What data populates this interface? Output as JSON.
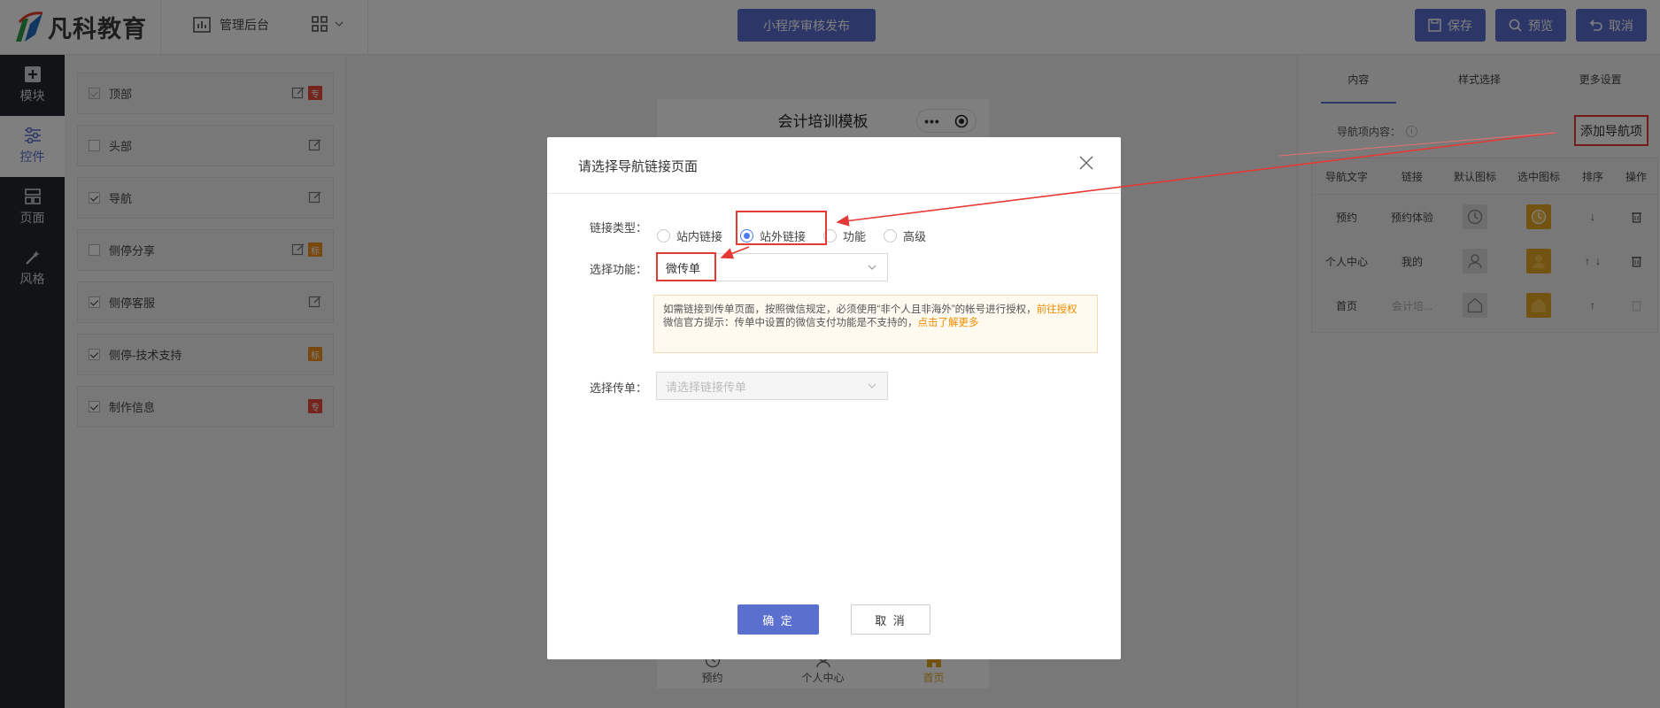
{
  "header": {
    "logo_text": "凡科教育",
    "admin_label": "管理后台",
    "publish_label": "小程序审核发布",
    "save_label": "保存",
    "preview_label": "预览",
    "cancel_label": "取消"
  },
  "sidebar": {
    "items": [
      {
        "label": "模块",
        "icon": "plus-square-icon"
      },
      {
        "label": "控件",
        "icon": "sliders-icon"
      },
      {
        "label": "页面",
        "icon": "layout-icon"
      },
      {
        "label": "风格",
        "icon": "magic-wand-icon"
      }
    ]
  },
  "components": [
    {
      "label": "顶部",
      "checked": true,
      "disabled": true,
      "edit": true,
      "tag": "专"
    },
    {
      "label": "头部",
      "checked": false,
      "edit": true,
      "tag": ""
    },
    {
      "label": "导航",
      "checked": true,
      "edit": true,
      "tag": ""
    },
    {
      "label": "侧停分享",
      "checked": false,
      "edit": true,
      "tag": "标"
    },
    {
      "label": "侧停客服",
      "checked": true,
      "edit": true,
      "tag": ""
    },
    {
      "label": "侧停-技术支持",
      "checked": true,
      "edit": false,
      "tag": "标"
    },
    {
      "label": "制作信息",
      "checked": true,
      "edit": false,
      "tag": "专"
    }
  ],
  "phone": {
    "title": "会计培训模板",
    "tabs": [
      "预约",
      "个人中心",
      "首页"
    ]
  },
  "right_panel": {
    "tabs": [
      "内容",
      "样式选择",
      "更多设置"
    ],
    "nav_content_label": "导航项内容：",
    "add_nav_label": "添加导航项",
    "table_headers": [
      "导航文字",
      "链接",
      "默认图标",
      "选中图标",
      "排序",
      "操作"
    ],
    "rows": [
      {
        "text": "预约",
        "link": "预约体验",
        "icon": "clock-icon"
      },
      {
        "text": "个人中心",
        "link": "我的",
        "icon": "person-icon"
      },
      {
        "text": "首页",
        "link": "会计培...",
        "icon": "home-icon"
      }
    ]
  },
  "modal": {
    "title": "请选择导航链接页面",
    "link_type_label": "链接类型：",
    "link_types": [
      "站内链接",
      "站外链接",
      "功能",
      "高级"
    ],
    "selected_link_type": "站外链接",
    "function_label": "选择功能：",
    "function_value": "微传单",
    "notice_line1_prefix": "如需链接到传单页面，按照微信规定，必须使用“非个人且非海外”的帐号进行授权，",
    "notice_line1_link": "前往授权",
    "notice_line2_prefix": "微信官方提示：传单中设置的微信支付功能是不支持的，",
    "notice_line2_link": "点击了解更多",
    "flyer_label": "选择传单：",
    "flyer_placeholder": "请选择链接传单",
    "ok_label": "确 定",
    "cancel_label": "取 消"
  },
  "colors": {
    "accent": "#5b6fcf",
    "sidebar_bg": "#23262e",
    "highlight": "#e53935",
    "warning_link": "#f08c00",
    "selected_icon": "#e6a623"
  }
}
